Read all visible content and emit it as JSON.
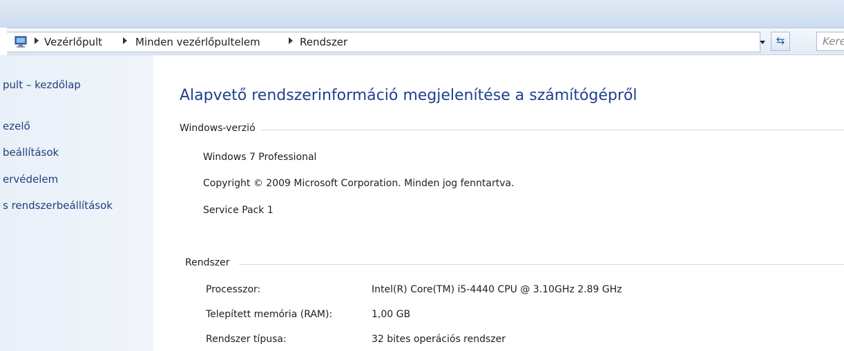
{
  "breadcrumb": {
    "items": [
      "Vezérlőpult",
      "Minden vezérlőpultelem",
      "Rendszer"
    ]
  },
  "search": {
    "placeholder": "Kere"
  },
  "left_pane": {
    "links": [
      "pult – kezdőlap",
      "ezelő",
      "beállítások",
      "ervédelem",
      "s rendszerbeállítások"
    ]
  },
  "main": {
    "title": "Alapvető rendszerinformáció megjelenítése a számítógépről",
    "windows_section": {
      "label": "Windows-verzió",
      "edition": "Windows 7 Professional",
      "copyright": "Copyright © 2009 Microsoft Corporation. Minden jog fenntartva.",
      "service_pack": "Service Pack 1"
    },
    "system_section": {
      "label": "Rendszer",
      "rows": [
        {
          "label": "Processzor:",
          "value": "Intel(R) Core(TM) i5-4440 CPU @ 3.10GHz   2.89 GHz"
        },
        {
          "label": "Telepített memória (RAM):",
          "value": "1,00 GB"
        },
        {
          "label": "Rendszer típusa:",
          "value": "32 bites operációs rendszer"
        }
      ]
    }
  },
  "icons": {
    "computer": "computer-icon",
    "separator": "chevron-right-icon",
    "dropdown": "chevron-down-icon",
    "refresh": "refresh-icon"
  },
  "colors": {
    "link": "#1f3f7a",
    "title": "#1f3f8f",
    "left_pane_bg": "#e9f0f8"
  }
}
